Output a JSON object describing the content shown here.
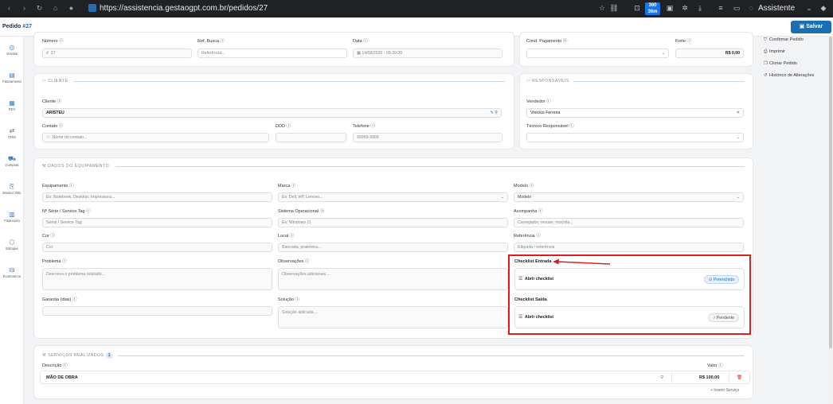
{
  "browser": {
    "url": "https://assistencia.gestaogpt.com.br/pedidos/27",
    "badge_top": "360",
    "badge_bottom": "36m",
    "assistant": "Assistente"
  },
  "header": {
    "title": "Pedido",
    "number": "#27",
    "save_label": "Salvar"
  },
  "sidebar": {
    "items": [
      {
        "label": "Vendas",
        "icon": "sales-icon"
      },
      {
        "label": "Faturamento",
        "icon": "invoice-icon"
      },
      {
        "label": "PDV",
        "icon": "pos-icon"
      },
      {
        "label": "CRM",
        "icon": "crm-icon"
      },
      {
        "label": "Compras",
        "icon": "cart-icon"
      },
      {
        "label": "Monitor XML",
        "icon": "xml-icon"
      },
      {
        "label": "Financeiro",
        "icon": "finance-icon"
      },
      {
        "label": "Estoque",
        "icon": "stock-icon"
      },
      {
        "label": "Ecommerce",
        "icon": "ecommerce-icon"
      }
    ]
  },
  "actions": {
    "confirm": "Confirmar Pedido",
    "print": "Imprimir",
    "clone": "Clonar Pedido",
    "history": "Histórico de Alterações"
  },
  "order": {
    "numero_label": "Número",
    "numero_value": "27",
    "ref_label": "Ref. Busca",
    "ref_placeholder": "Referência...",
    "data_label": "Data",
    "data_value": "14/08/2026 - 09:39:00",
    "cond_label": "Cond. Pagamento",
    "frete_label": "Frete",
    "frete_value": "R$ 0,00"
  },
  "cliente": {
    "section": "CLIENTE",
    "cliente_label": "Cliente",
    "cliente_value": "ARISTEU",
    "contato_label": "Contato",
    "contato_placeholder": "Nome do contato...",
    "ddd_label": "DDD",
    "telefone_label": "Telefone",
    "telefone_placeholder": "99999-9999"
  },
  "responsaveis": {
    "section": "RESPONSÁVEIS",
    "vendedor_label": "Vendedor",
    "vendedor_value": "Vinicius Ferreira",
    "tecnico_label": "Técnico Responsável"
  },
  "equipamento": {
    "section": "DADOS DO EQUIPAMENTO",
    "equip_label": "Equipamento",
    "equip_placeholder": "Ex: Notebook, Desktop, Impressora...",
    "marca_label": "Marca",
    "marca_placeholder": "Ex: Dell, HP, Lenovo...",
    "modelo_label": "Modelo",
    "modelo_value": "Modelo",
    "serie_label": "Nº Série / Service Tag",
    "serie_placeholder": "Serial / Service Tag",
    "so_label": "Sistema Operacional",
    "so_placeholder": "Ex: Windows 11",
    "acomp_label": "Acompanha",
    "acomp_placeholder": "Carregador, mouse, mochila...",
    "cor_label": "Cor",
    "cor_placeholder": "Cor",
    "local_label": "Local",
    "local_placeholder": "Bancada, prateleira...",
    "ref_label": "Referência",
    "ref_placeholder": "Etiqueta / referência",
    "problema_label": "Problema",
    "problema_placeholder": "Descreva o problema relatado...",
    "obs_label": "Observações",
    "obs_placeholder": "Observações adicionais...",
    "garantia_label": "Garantia (dias)",
    "solucao_label": "Solução",
    "solucao_placeholder": "Solução aplicada...",
    "checklist_entrada_label": "Checklist Entrada",
    "checklist_entrada_action": "Abrir checklist",
    "checklist_entrada_status": "Preenchida",
    "checklist_saida_label": "Checklist Saída",
    "checklist_saida_action": "Abrir checklist",
    "checklist_saida_status": "Pendente"
  },
  "servicos": {
    "section": "SERVIÇOS REALIZADOS",
    "count": "1",
    "desc_label": "Descrição",
    "valor_label": "Valor",
    "rows": [
      {
        "descricao": "MÃO DE OBRA",
        "valor": "R$ 100,00"
      }
    ],
    "insert_label": "+ Inserir Serviço"
  },
  "colors": {
    "accent": "#1a6fb3",
    "highlight": "#e11d1d",
    "sidebar_icon": "#3b7fc4"
  }
}
